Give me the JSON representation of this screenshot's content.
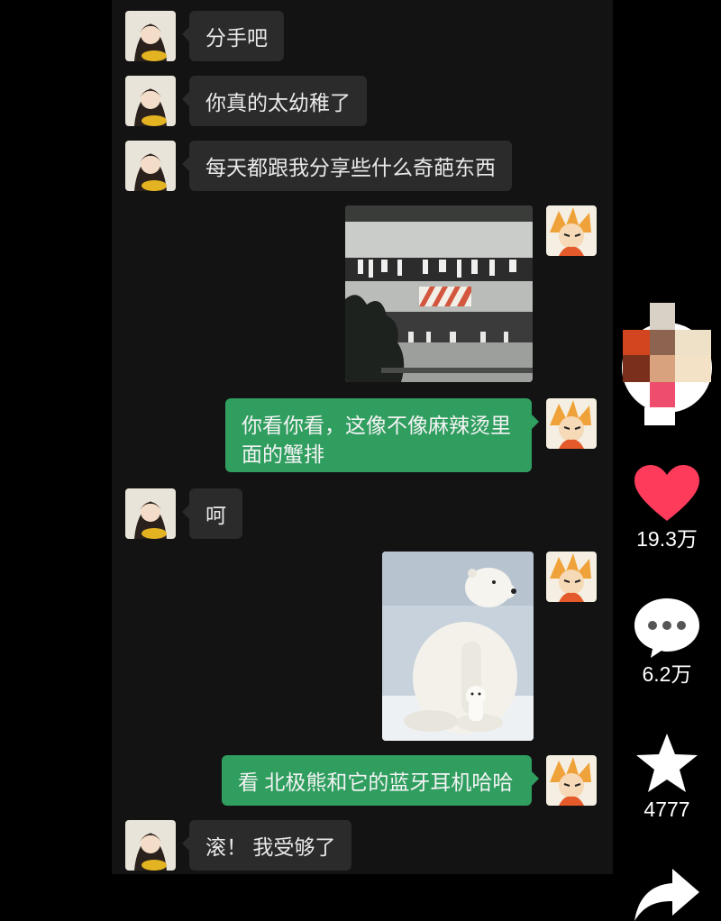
{
  "messages": [
    {
      "side": "left",
      "type": "text",
      "text": "分手吧"
    },
    {
      "side": "left",
      "type": "text",
      "text": "你真的太幼稚了"
    },
    {
      "side": "left",
      "type": "text",
      "text": "每天都跟我分享些什么奇葩东西"
    },
    {
      "side": "right",
      "type": "image",
      "subject": "building-balcony-photo"
    },
    {
      "side": "right",
      "type": "text",
      "text": "你看你看，这像不像麻辣烫里面的蟹排"
    },
    {
      "side": "left",
      "type": "text",
      "text": "呵"
    },
    {
      "side": "right",
      "type": "image",
      "subject": "polar-bear-photo"
    },
    {
      "side": "right",
      "type": "text",
      "text": "看 北极熊和它的蓝牙耳机哈哈"
    },
    {
      "side": "left",
      "type": "text",
      "text": "滚！ 我受够了"
    }
  ],
  "sidebar": {
    "likes": "19.3万",
    "comments": "6.2万",
    "favorites": "4777",
    "like_color": "#ff3b5c",
    "icons": [
      "creator-avatar",
      "heart-icon",
      "comment-icon",
      "star-icon",
      "share-icon"
    ]
  },
  "colors": {
    "background": "#000000",
    "chat_background": "#131313",
    "received_bubble": "#2b2b2b",
    "sent_bubble": "#2f9e5f"
  }
}
